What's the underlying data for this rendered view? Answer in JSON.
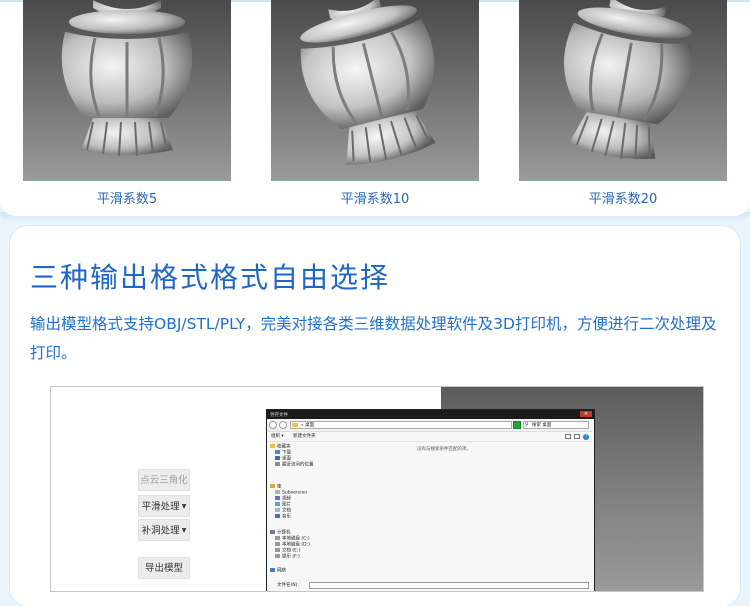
{
  "gallery": {
    "items": [
      {
        "caption": "平滑系数5"
      },
      {
        "caption": "平滑系数10"
      },
      {
        "caption": "平滑系数20"
      }
    ]
  },
  "feature": {
    "title": "三种输出格式格式自由选择",
    "description": "输出模型格式支持OBJ/STL/PLY，完美对接各类三维数据处理软件及3D打印机，方便进行二次处理及打印。"
  },
  "app": {
    "buttons": [
      {
        "label": "点云三角化",
        "enabled": false,
        "dropdown": false
      },
      {
        "label": "平滑处理",
        "enabled": true,
        "dropdown": true
      },
      {
        "label": "补洞处理",
        "enabled": true,
        "dropdown": true
      },
      {
        "label": "导出模型",
        "enabled": true,
        "dropdown": false
      }
    ],
    "dialog": {
      "title": "另存文件",
      "close": "×",
      "address": "« 桌面",
      "search_placeholder": "搜索 桌面",
      "organize": "组织 ▾",
      "new_folder": "新建文件夹",
      "empty_message": "没有与搜索条件匹配的项。",
      "filename_label": "文件名(N):",
      "nav": {
        "favorites": "收藏夹",
        "favorites_items": [
          "下载",
          "桌面",
          "最近访问的位置"
        ],
        "libraries": "库",
        "library_items": [
          "Subversion",
          "视频",
          "图片",
          "文档",
          "音乐"
        ],
        "computer": "计算机",
        "computer_items": [
          "本地磁盘 (C:)",
          "本地磁盘 (D:)",
          "文档 (E:)",
          "娱乐 (F:)"
        ],
        "network": "网络"
      }
    },
    "colors": {
      "accent": "#1e66c8",
      "caption": "#2a66b8",
      "folder": "#e8c15a"
    }
  }
}
